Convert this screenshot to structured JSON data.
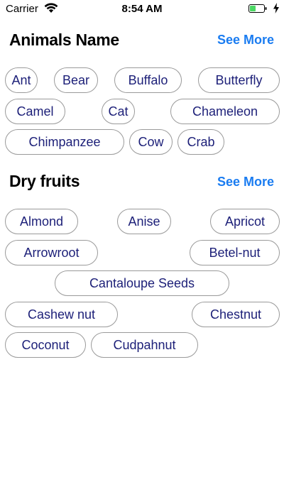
{
  "status_bar": {
    "carrier": "Carrier",
    "time": "8:54 AM",
    "icons": [
      "wifi-icon",
      "battery-icon",
      "charging-bolt-icon"
    ],
    "battery_color": "#4cd964"
  },
  "sections": [
    {
      "title": "Animals Name",
      "see_more": "See More",
      "chips": [
        "Ant",
        "Bear",
        "Buffalo",
        "Butterfly",
        "Camel",
        "Cat",
        "Chameleon",
        "Chimpanzee",
        "Cow",
        "Crab"
      ]
    },
    {
      "title": "Dry fruits",
      "see_more": "See More",
      "chips": [
        "Almond",
        "Anise",
        "Apricot",
        "Arrowroot",
        "Betel-nut",
        "Cantaloupe Seeds",
        "Cashew nut",
        "Chestnut",
        "Coconut",
        "Cudpahnut"
      ]
    }
  ],
  "colors": {
    "accent": "#1a7cf1",
    "chip_text": "#1c1f78",
    "chip_border": "#9a9a9a"
  }
}
